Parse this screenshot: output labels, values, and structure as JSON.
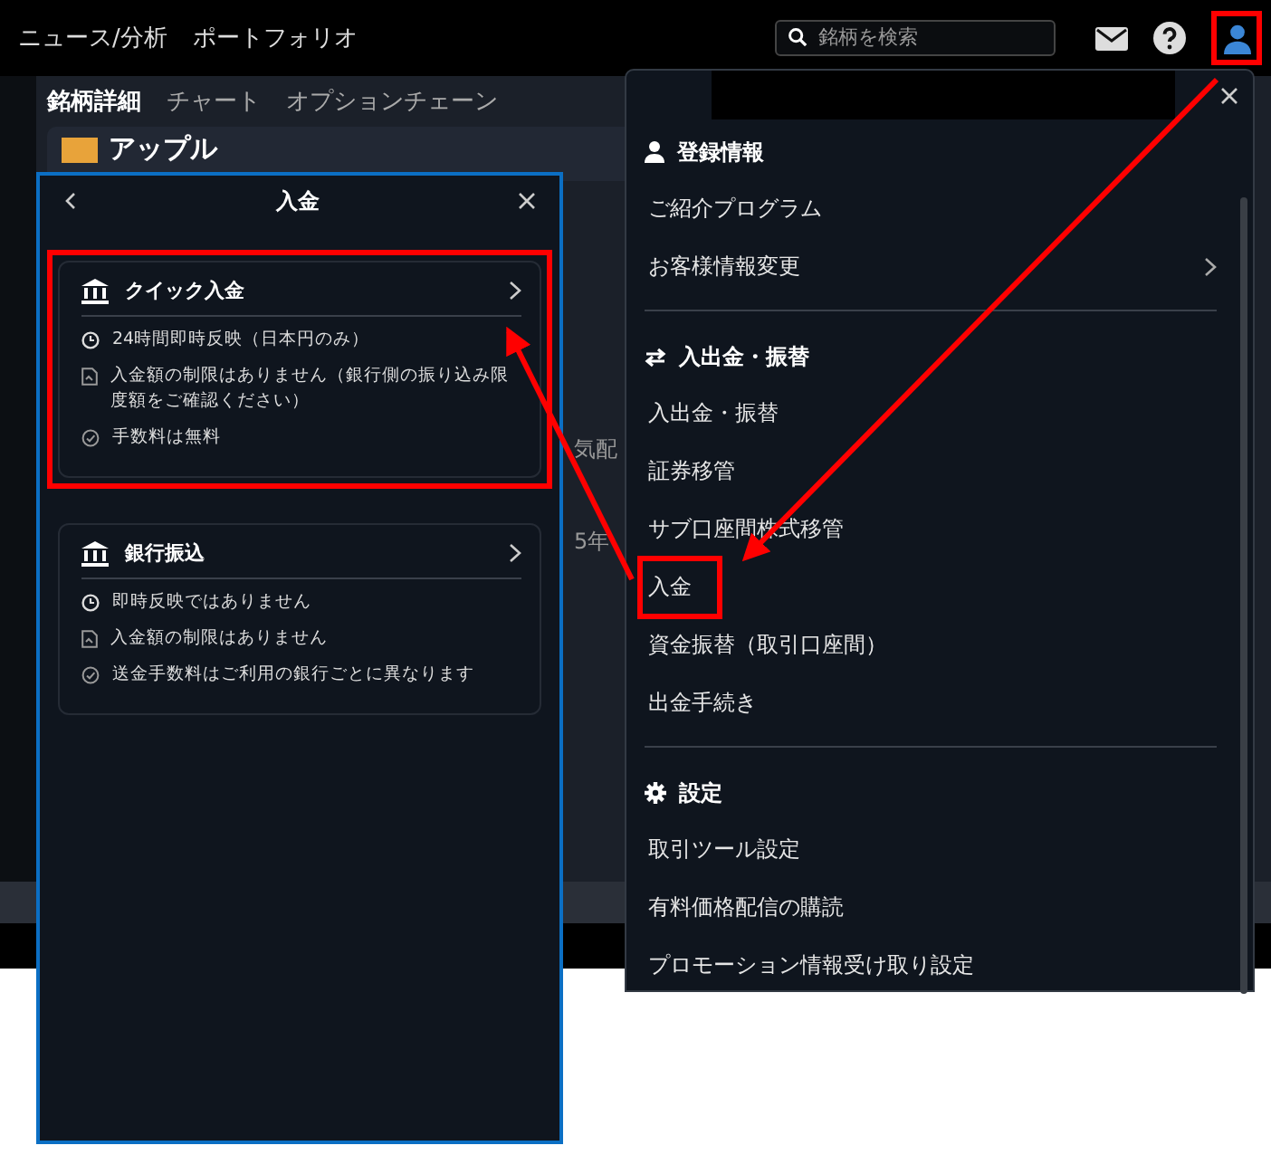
{
  "top_nav": [
    {
      "label": "ニュース/分析"
    },
    {
      "label": "ポートフォリオ"
    }
  ],
  "search": {
    "placeholder": "銘柄を検索"
  },
  "user_button": {
    "highlighted": true
  },
  "tabs": [
    {
      "label": "銘柄詳細",
      "selected": true
    },
    {
      "label": "チャート",
      "selected": false
    },
    {
      "label": "オプションチェーン",
      "selected": false
    }
  ],
  "stock": {
    "name": "アップル"
  },
  "background_cells": [
    "気配",
    "5年"
  ],
  "deposit_panel": {
    "title": "入金",
    "methods": [
      {
        "title": "クイック入金",
        "highlighted": true,
        "features": [
          {
            "kind": "clock",
            "text": "24時間即時反映（日本円のみ）"
          },
          {
            "kind": "document",
            "text": "入金額の制限はありません（銀行側の振り込み限度額をご確認ください）"
          },
          {
            "kind": "check",
            "text": "手数料は無料"
          }
        ]
      },
      {
        "title": "銀行振込",
        "highlighted": false,
        "features": [
          {
            "kind": "clock",
            "text": "即時反映ではありません"
          },
          {
            "kind": "document",
            "text": "入金額の制限はありません"
          },
          {
            "kind": "check",
            "text": "送金手数料はご利用の銀行ごとに異なります"
          }
        ]
      }
    ]
  },
  "account_menu": {
    "sections": [
      {
        "kind": "user",
        "heading": "登録情報",
        "items": [
          {
            "label": "ご紹介プログラム",
            "submenu": false,
            "highlighted": false
          },
          {
            "label": "お客様情報変更",
            "submenu": true,
            "highlighted": false
          }
        ]
      },
      {
        "kind": "transfer",
        "heading": "入出金・振替",
        "items": [
          {
            "label": "入出金・振替",
            "submenu": false,
            "highlighted": false
          },
          {
            "label": "証券移管",
            "submenu": false,
            "highlighted": false
          },
          {
            "label": "サブ口座間株式移管",
            "submenu": false,
            "highlighted": false
          },
          {
            "label": "入金",
            "submenu": false,
            "highlighted": true
          },
          {
            "label": "資金振替（取引口座間）",
            "submenu": false,
            "highlighted": false
          },
          {
            "label": "出金手続き",
            "submenu": false,
            "highlighted": false
          }
        ]
      },
      {
        "kind": "settings",
        "heading": "設定",
        "items": [
          {
            "label": "取引ツール設定",
            "submenu": false,
            "highlighted": false
          },
          {
            "label": "有料価格配信の購読",
            "submenu": false,
            "highlighted": false
          },
          {
            "label": "プロモーション情報受け取り設定",
            "submenu": false,
            "highlighted": false
          }
        ]
      }
    ]
  }
}
